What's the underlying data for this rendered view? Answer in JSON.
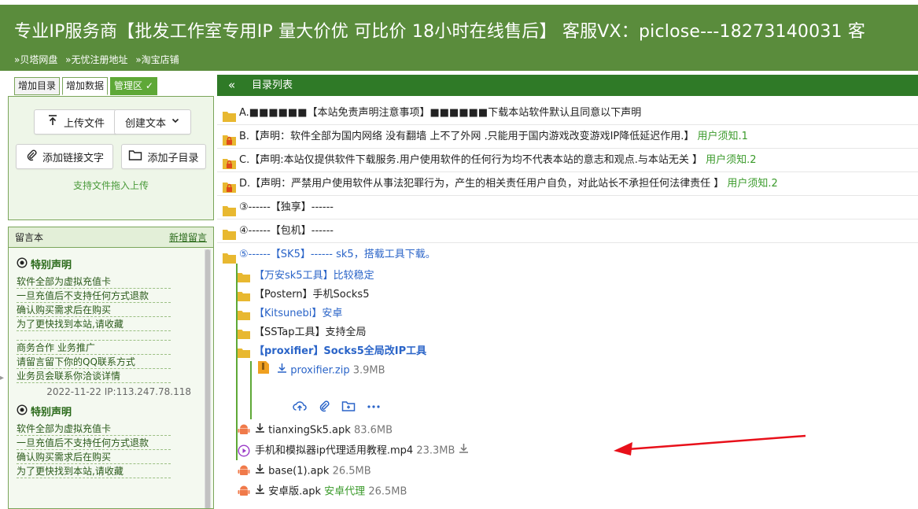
{
  "header": {
    "title": "专业IP服务商【批发工作室专用IP 量大价优 可比价 18小时在线售后】 客服VX：piclose---18273140031 客",
    "links": [
      "»贝塔网盘",
      "»无忧注册地址",
      "»淘宝店铺"
    ]
  },
  "tabs": [
    "增加目录",
    "增加数据",
    "管理区"
  ],
  "toolbox": {
    "upload": "上传文件",
    "create_text": "创建文本",
    "add_link": "添加链接文字",
    "add_subdir": "添加子目录",
    "drop_hint": "支持文件拖入上传"
  },
  "messages": {
    "title": "留言本",
    "new_label": "新增留言",
    "sections": [
      {
        "title": "特别声明",
        "lines": [
          "软件全部为虚拟充值卡",
          "一旦充值后不支持任何方式退款",
          "确认购买需求后在购买",
          "为了更快找到本站,请收藏"
        ],
        "lines2": [
          "商务合作  业务推广",
          "请留言留下你的QQ联系方式",
          "业务员会联系你洽谈详情"
        ],
        "meta": "2022-11-22 IP:113.247.78.118"
      },
      {
        "title": "特别声明",
        "lines": [
          "软件全部为虚拟充值卡",
          "一旦充值后不支持任何方式退款",
          "确认购买需求后在购买",
          "为了更快找到本站,请收藏"
        ]
      }
    ]
  },
  "list": {
    "header": "目录列表",
    "rows": [
      {
        "text": "A.■■■■■■【本站免责声明注意事项】■■■■■■下载本站软件默认且同意以下声明",
        "note": "",
        "icon": "folder"
      },
      {
        "text": "B.【声明：软件全部为国内网络 没有翻墙 上不了外网 .只能用于国内游戏改变游戏IP降低延迟作用.】",
        "note": "用户须知.1",
        "icon": "lock"
      },
      {
        "text": "C.【声明:本站仅提供软件下载服务.用户使用软件的任何行为均不代表本站的意志和观点.与本站无关 】",
        "note": "用户须知.2",
        "icon": "lock"
      },
      {
        "text": "D.【声明：严禁用户使用软件从事法犯罪行为，产生的相关责任用户自负，对此站长不承担任何法律责任 】",
        "note": "用户须知.2",
        "icon": "lock"
      },
      {
        "text": "③------【独享】------",
        "note": "",
        "icon": "folder"
      },
      {
        "text": "④------【包机】------",
        "note": "",
        "icon": "folder"
      },
      {
        "text": "⑤------【SK5】------ sk5，搭载工具下载。",
        "note": "",
        "icon": "folder"
      }
    ],
    "subfolders": [
      {
        "text": "【万安sk5工具】比较稳定",
        "style": "blue"
      },
      {
        "text": "【Postern】手机Socks5",
        "style": "normal"
      },
      {
        "text": "【Kitsunebi】安卓",
        "style": "blue"
      },
      {
        "text": "【SSTap工具】支持全局",
        "style": "normal"
      },
      {
        "text": "【proxifier】Socks5全局改IP工具",
        "style": "bold-blue"
      }
    ],
    "zip": {
      "name": "proxifier.zip",
      "size": "3.9MB"
    },
    "files": [
      {
        "name": "tianxingSk5.apk",
        "extra": "",
        "size": "83.6MB",
        "icon": "android"
      },
      {
        "name": "手机和模拟器ip代理适用教程.mp4",
        "extra": "",
        "size": "23.3MB",
        "icon": "video"
      },
      {
        "name": "base(1).apk",
        "extra": "",
        "size": "26.5MB",
        "icon": "android"
      },
      {
        "name": "安卓版.apk",
        "extra": "安卓代理",
        "size": "26.5MB",
        "icon": "android"
      }
    ]
  },
  "colors": {
    "header_bg": "#5a8c3c",
    "list_header_bg": "#2f7a27",
    "accent_green": "#3a9a2a",
    "link_blue": "#2a64c8",
    "annotation_red": "#e8101a"
  }
}
